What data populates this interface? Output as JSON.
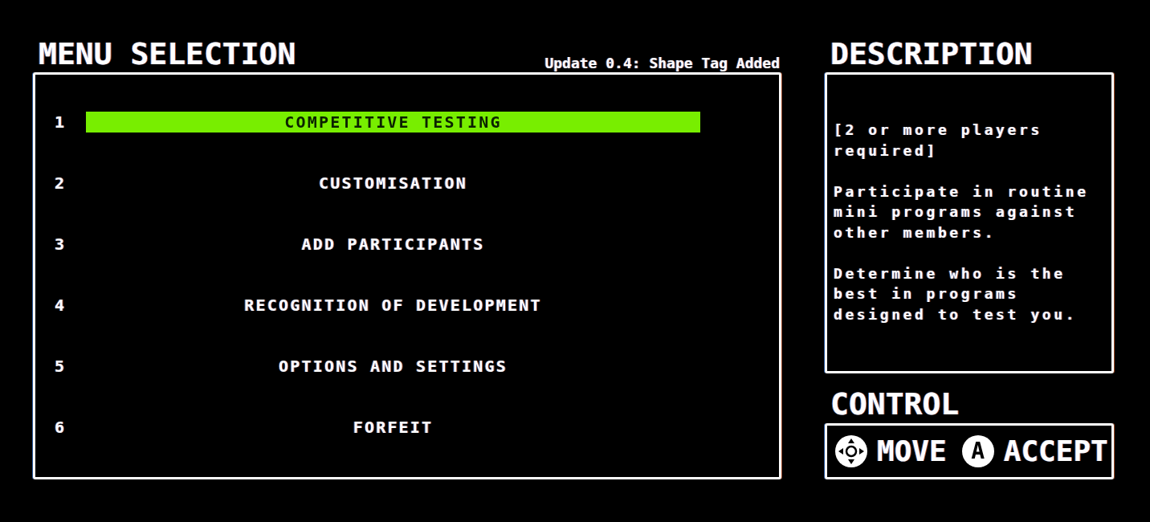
{
  "menu": {
    "title": "MENU SELECTION",
    "update_note": "Update 0.4: Shape Tag Added",
    "items": [
      {
        "number": "1",
        "label": "COMPETITIVE TESTING",
        "selected": true
      },
      {
        "number": "2",
        "label": "CUSTOMISATION",
        "selected": false
      },
      {
        "number": "3",
        "label": "ADD PARTICIPANTS",
        "selected": false
      },
      {
        "number": "4",
        "label": "RECOGNITION OF DEVELOPMENT",
        "selected": false
      },
      {
        "number": "5",
        "label": "OPTIONS AND SETTINGS",
        "selected": false
      },
      {
        "number": "6",
        "label": "FORFEIT",
        "selected": false
      }
    ]
  },
  "description": {
    "title": "DESCRIPTION",
    "paragraphs": [
      "[2 or more players required]",
      "Participate in routine mini programs against other members.",
      "Determine who is the best in programs designed to test you."
    ]
  },
  "control": {
    "title": "CONTROL",
    "hints": [
      {
        "kind": "dpad",
        "label": "MOVE"
      },
      {
        "kind": "button",
        "glyph": "A",
        "label": "ACCEPT"
      }
    ]
  }
}
